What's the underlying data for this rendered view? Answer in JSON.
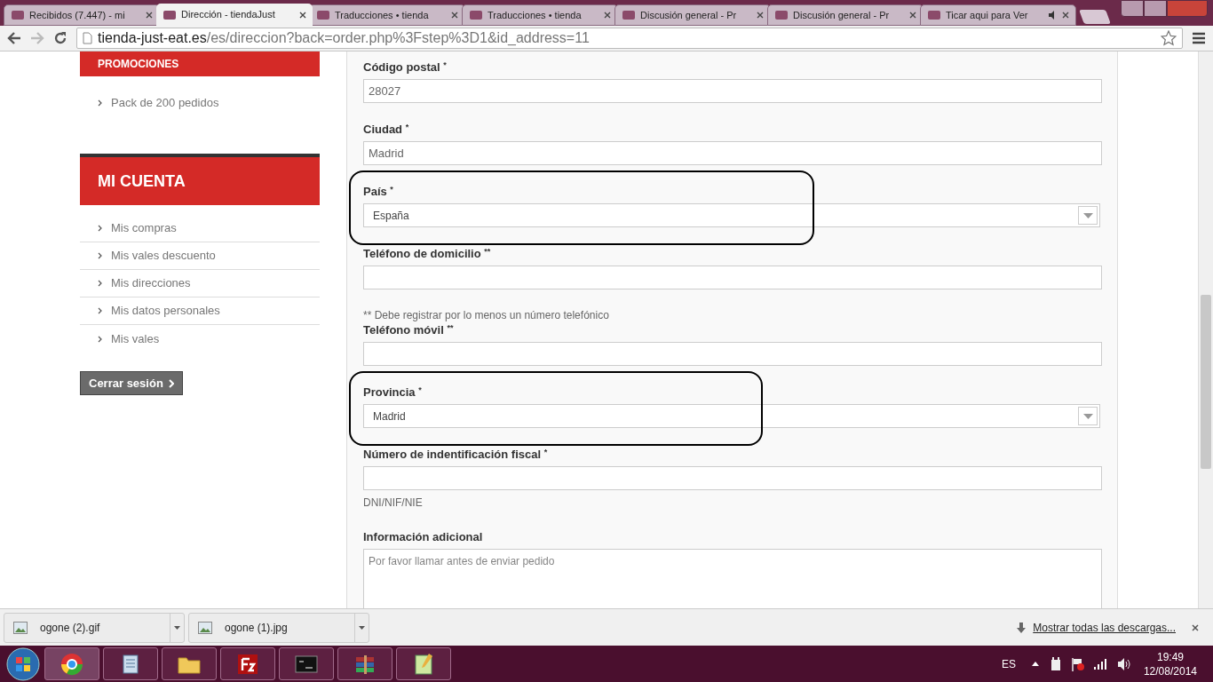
{
  "browser": {
    "tabs": [
      {
        "title": "Recibidos (7.447) - mi",
        "selected": false,
        "audio": false
      },
      {
        "title": "Dirección - tiendaJust",
        "selected": true,
        "audio": false
      },
      {
        "title": "Traducciones • tienda",
        "selected": false,
        "audio": false
      },
      {
        "title": "Traducciones • tienda",
        "selected": false,
        "audio": false
      },
      {
        "title": "Discusión general - Pr",
        "selected": false,
        "audio": false
      },
      {
        "title": "Discusión general - Pr",
        "selected": false,
        "audio": false
      },
      {
        "title": "Ticar aqui para Ver",
        "selected": false,
        "audio": true
      }
    ],
    "url_host": "tienda-just-eat.es",
    "url_path": "/es/direccion?back=order.php%3Fstep%3D1&id_address=11"
  },
  "sidebar": {
    "sections": [
      {
        "title": "PROMOCIONES",
        "items": [
          "Pack de 200 pedidos"
        ]
      },
      {
        "title": "MI CUENTA",
        "items": [
          "Mis compras",
          "Mis vales descuento",
          "Mis direcciones",
          "Mis datos personales",
          "Mis vales"
        ]
      }
    ],
    "logout_button": "Cerrar sesión"
  },
  "form": [
    {
      "kind": "input",
      "label": "Código postal",
      "mark": "*",
      "value": "28027",
      "highlighted": false
    },
    {
      "kind": "input",
      "label": "Ciudad",
      "mark": "*",
      "value": "Madrid",
      "highlighted": false
    },
    {
      "kind": "select",
      "label": "País",
      "mark": "*",
      "value": "España",
      "highlighted": true
    },
    {
      "kind": "input",
      "label": "Teléfono de domicilio",
      "mark": "**",
      "highlighted": false
    },
    {
      "kind": "note",
      "text": "** Debe registrar por lo menos un número telefónico"
    },
    {
      "kind": "input",
      "label": "Teléfono móvil",
      "mark": "**",
      "highlighted": false
    },
    {
      "kind": "select",
      "label": "Provincia",
      "mark": "*",
      "value": "Madrid",
      "highlighted": true
    },
    {
      "kind": "input",
      "label": "Número de indentificación fiscal",
      "mark": "*",
      "hint": "DNI/NIF/NIE",
      "highlighted": false
    },
    {
      "kind": "textarea",
      "label": "Información adicional",
      "placeholder": "Por favor llamar antes de enviar pedido",
      "highlighted": false
    }
  ],
  "downloads": {
    "files": [
      "ogone (2).gif",
      "ogone (1).jpg"
    ],
    "show_all": "Mostrar todas las descargas..."
  },
  "taskbar": {
    "language": "ES",
    "time": "19:49",
    "date": "12/08/2014"
  }
}
